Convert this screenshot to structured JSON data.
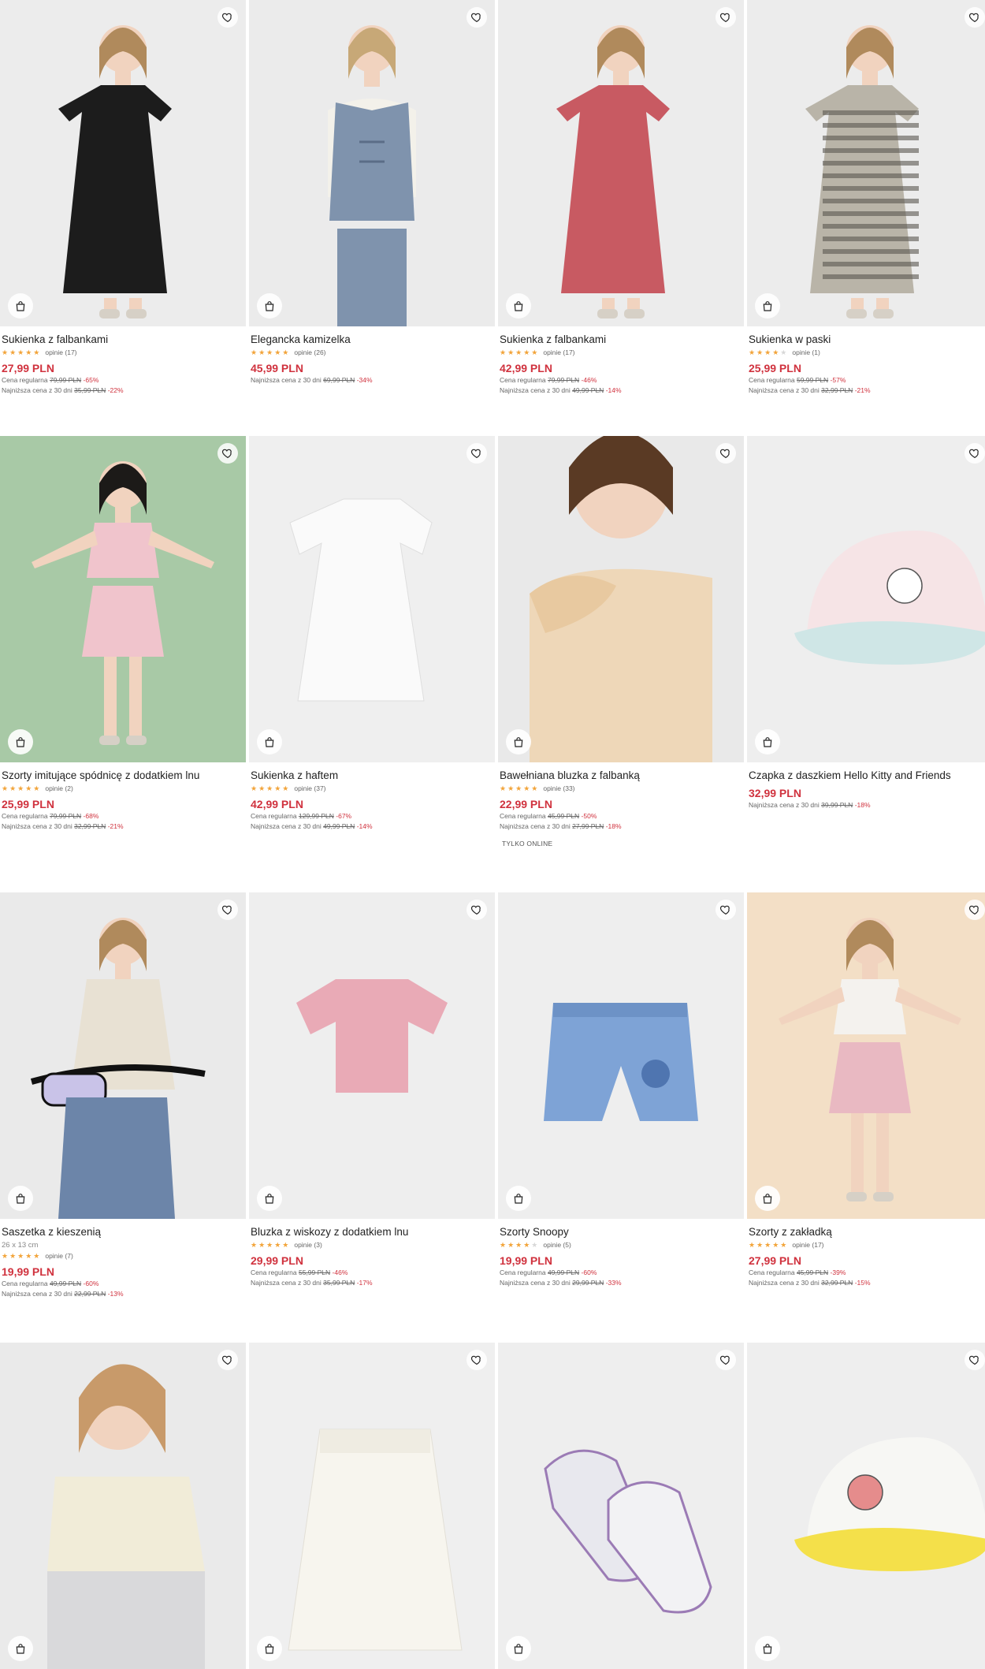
{
  "labels": {
    "regular": "Cena regularna",
    "lowest": "Najniższa cena z 30 dni"
  },
  "colors": {
    "accent": "#d0323e",
    "stars": "#f2a43a"
  },
  "products": [
    {
      "name": "Sukienka z falbankami",
      "rating": 4.5,
      "reviews": "opinie (17)",
      "price": "27,99 PLN",
      "regular_old": "79,99 PLN",
      "regular_disc": "-65%",
      "lowest_old": "35,99 PLN",
      "lowest_disc": "-22%",
      "bg": "#ececec",
      "garment": "#1c1c1c",
      "kind": "dress"
    },
    {
      "name": "Elegancka kamizelka",
      "rating": 5,
      "reviews": "opinie (26)",
      "price": "45,99 PLN",
      "lowest_old": "69,99 PLN",
      "lowest_disc": "-34%",
      "bg": "#ebebeb",
      "garment": "#7f93ad",
      "kind": "vest"
    },
    {
      "name": "Sukienka z falbankami",
      "rating": 4.5,
      "reviews": "opinie (17)",
      "price": "42,99 PLN",
      "regular_old": "79,99 PLN",
      "regular_disc": "-46%",
      "lowest_old": "49,99 PLN",
      "lowest_disc": "-14%",
      "bg": "#ececec",
      "garment": "#c85a62",
      "kind": "dress"
    },
    {
      "name": "Sukienka w paski",
      "rating": 4,
      "reviews": "opinie (1)",
      "price": "25,99 PLN",
      "regular_old": "59,99 PLN",
      "regular_disc": "-57%",
      "lowest_old": "32,99 PLN",
      "lowest_disc": "-21%",
      "bg": "#ececec",
      "garment": "#b9b4a8",
      "kind": "stripe"
    },
    {
      "name": "Szorty imitujące spódnicę z dodatkiem lnu",
      "rating": 5,
      "reviews": "opinie (2)",
      "price": "25,99 PLN",
      "regular_old": "79,99 PLN",
      "regular_disc": "-68%",
      "lowest_old": "32,99 PLN",
      "lowest_disc": "-21%",
      "bg": "#a8c9a6",
      "garment": "#f0c4cc",
      "kind": "girl-set"
    },
    {
      "name": "Sukienka z haftem",
      "rating": 5,
      "reviews": "opinie (37)",
      "price": "42,99 PLN",
      "regular_old": "129,99 PLN",
      "regular_disc": "-67%",
      "lowest_old": "49,99 PLN",
      "lowest_disc": "-14%",
      "bg": "#efefef",
      "garment": "#fafafa",
      "kind": "flat-dress"
    },
    {
      "name": "Bawełniana bluzka z falbanką",
      "rating": 5,
      "reviews": "opinie (33)",
      "price": "22,99 PLN",
      "regular_old": "45,99 PLN",
      "regular_disc": "-50%",
      "lowest_old": "27,99 PLN",
      "lowest_disc": "-18%",
      "tag": "TYLKO ONLINE",
      "bg": "#e9e9e9",
      "garment": "#eed7b8",
      "kind": "blouse"
    },
    {
      "name": "Czapka z daszkiem Hello Kitty and Friends",
      "price": "32,99 PLN",
      "lowest_old": "39,99 PLN",
      "lowest_disc": "-18%",
      "bg": "#eeeeee",
      "garment": "#f6e4e6",
      "kind": "cap"
    },
    {
      "name": "Saszetka z kieszenią",
      "dims": "26 x 13 cm",
      "rating": 5,
      "reviews": "opinie (7)",
      "price": "19,99 PLN",
      "regular_old": "49,99 PLN",
      "regular_disc": "-60%",
      "lowest_old": "22,99 PLN",
      "lowest_disc": "-13%",
      "bg": "#eaeaea",
      "garment": "#e8e1d3",
      "kind": "bag"
    },
    {
      "name": "Bluzka z wiskozy z dodatkiem lnu",
      "rating": 5,
      "reviews": "opinie (3)",
      "price": "29,99 PLN",
      "regular_old": "55,99 PLN",
      "regular_disc": "-46%",
      "lowest_old": "35,99 PLN",
      "lowest_disc": "-17%",
      "bg": "#eeeeee",
      "garment": "#e9aab6",
      "kind": "tee"
    },
    {
      "name": "Szorty Snoopy",
      "rating": 4,
      "reviews": "opinie (5)",
      "price": "19,99 PLN",
      "regular_old": "49,99 PLN",
      "regular_disc": "-60%",
      "lowest_old": "29,99 PLN",
      "lowest_disc": "-33%",
      "bg": "#eeeeee",
      "garment": "#7ea3d6",
      "kind": "shorts"
    },
    {
      "name": "Szorty z zakładką",
      "rating": 5,
      "reviews": "opinie (17)",
      "price": "27,99 PLN",
      "regular_old": "45,99 PLN",
      "regular_disc": "-39%",
      "lowest_old": "32,99 PLN",
      "lowest_disc": "-15%",
      "bg": "#f3dfc6",
      "garment": "#e9b9c2",
      "kind": "girl-shorts"
    },
    {
      "name": "",
      "bg": "#eaeaea",
      "garment": "#f1ecd8",
      "kind": "sit"
    },
    {
      "name": "",
      "bg": "#efefef",
      "garment": "#f7f5ee",
      "kind": "skirt"
    },
    {
      "name": "",
      "bg": "#eeeeee",
      "garment": "#e8e8ee",
      "kind": "shoes"
    },
    {
      "name": "",
      "bg": "#eeeeee",
      "garment": "#f4e04a",
      "kind": "cap2"
    }
  ]
}
